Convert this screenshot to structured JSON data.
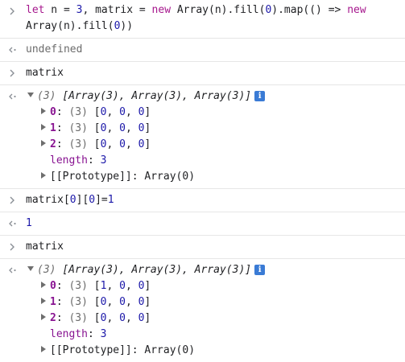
{
  "console": {
    "entries": [
      {
        "type": "input",
        "lines": [
          [
            "let",
            " n = ",
            "3",
            ", matrix = ",
            "new",
            " Array(n).fill(",
            "0",
            ").map(() => ",
            "new"
          ],
          [
            "Array(n).fill(",
            "0",
            "))"
          ]
        ]
      },
      {
        "type": "result",
        "text": "undefined"
      },
      {
        "type": "input",
        "text": "matrix"
      },
      {
        "type": "object",
        "summary_count": "(3)",
        "summary": "[Array(3), Array(3), Array(3)]",
        "info": "i",
        "rows": [
          {
            "key": "0",
            "count": "(3)",
            "values": [
              "0",
              "0",
              "0"
            ]
          },
          {
            "key": "1",
            "count": "(3)",
            "values": [
              "0",
              "0",
              "0"
            ]
          },
          {
            "key": "2",
            "count": "(3)",
            "values": [
              "0",
              "0",
              "0"
            ]
          }
        ],
        "length_key": "length",
        "length_value": "3",
        "proto_key": "[[Prototype]]",
        "proto_value": "Array(0)"
      },
      {
        "type": "input",
        "text_a": "matrix[",
        "num_a": "0",
        "text_b": "][",
        "num_b": "0",
        "text_c": "]=",
        "num_c": "1"
      },
      {
        "type": "result",
        "text": "1"
      },
      {
        "type": "input",
        "text": "matrix"
      },
      {
        "type": "object",
        "summary_count": "(3)",
        "summary": "[Array(3), Array(3), Array(3)]",
        "info": "i",
        "rows": [
          {
            "key": "0",
            "count": "(3)",
            "values": [
              "1",
              "0",
              "0"
            ]
          },
          {
            "key": "1",
            "count": "(3)",
            "values": [
              "0",
              "0",
              "0"
            ]
          },
          {
            "key": "2",
            "count": "(3)",
            "values": [
              "0",
              "0",
              "0"
            ]
          }
        ],
        "length_key": "length",
        "length_value": "3",
        "proto_key": "[[Prototype]]",
        "proto_value": "Array(0)"
      }
    ]
  }
}
